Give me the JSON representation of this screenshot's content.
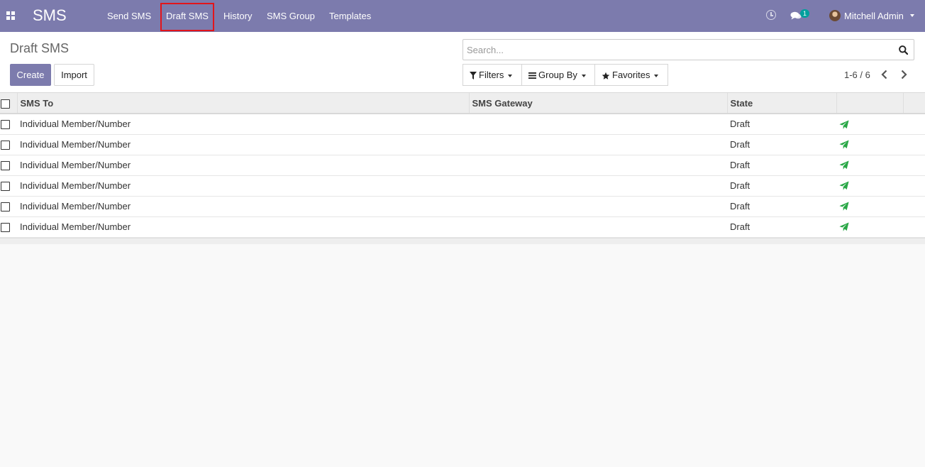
{
  "navbar": {
    "app_name": "SMS",
    "menu": [
      {
        "label": "Send SMS"
      },
      {
        "label": "Draft SMS"
      },
      {
        "label": "History"
      },
      {
        "label": "SMS Group"
      },
      {
        "label": "Templates"
      }
    ],
    "active_menu": "Draft SMS",
    "chat_badge": "1",
    "user_name": "Mitchell Admin",
    "color": "#7c7bad",
    "highlight_color": "#e2151b"
  },
  "control_panel": {
    "title": "Draft SMS",
    "create_label": "Create",
    "import_label": "Import",
    "search_placeholder": "Search...",
    "filters_label": "Filters",
    "groupby_label": "Group By",
    "favorites_label": "Favorites",
    "pager_value": "1-6 / 6"
  },
  "table": {
    "columns": [
      "SMS To",
      "SMS Gateway",
      "State"
    ],
    "rows": [
      {
        "sms_to": "Individual Member/Number",
        "gateway": "",
        "state": "Draft"
      },
      {
        "sms_to": "Individual Member/Number",
        "gateway": "",
        "state": "Draft"
      },
      {
        "sms_to": "Individual Member/Number",
        "gateway": "",
        "state": "Draft"
      },
      {
        "sms_to": "Individual Member/Number",
        "gateway": "",
        "state": "Draft"
      },
      {
        "sms_to": "Individual Member/Number",
        "gateway": "",
        "state": "Draft"
      },
      {
        "sms_to": "Individual Member/Number",
        "gateway": "",
        "state": "Draft"
      }
    ],
    "send_icon": "paper-plane-icon",
    "send_icon_color": "#28a745"
  }
}
